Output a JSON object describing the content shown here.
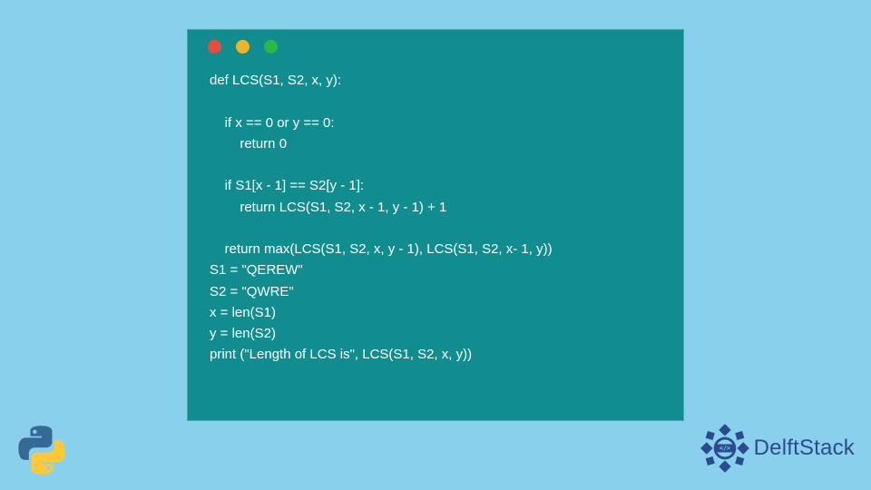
{
  "code": {
    "lines": [
      "def LCS(S1, S2, x, y):",
      "",
      "    if x == 0 or y == 0:",
      "        return 0",
      "",
      "    if S1[x - 1] == S2[y - 1]:",
      "        return LCS(S1, S2, x - 1, y - 1) + 1",
      "",
      "    return max(LCS(S1, S2, x, y - 1), LCS(S1, S2, x- 1, y))",
      "S1 = \"QEREW\"",
      "S2 = \"QWRE\"",
      "x = len(S1)",
      "y = len(S2)",
      "print (\"Length of LCS is\", LCS(S1, S2, x, y))"
    ]
  },
  "brand": {
    "name": "DelftStack"
  },
  "window_dots": {
    "red": "#e94b3c",
    "yellow": "#f0b429",
    "green": "#2fb648"
  }
}
